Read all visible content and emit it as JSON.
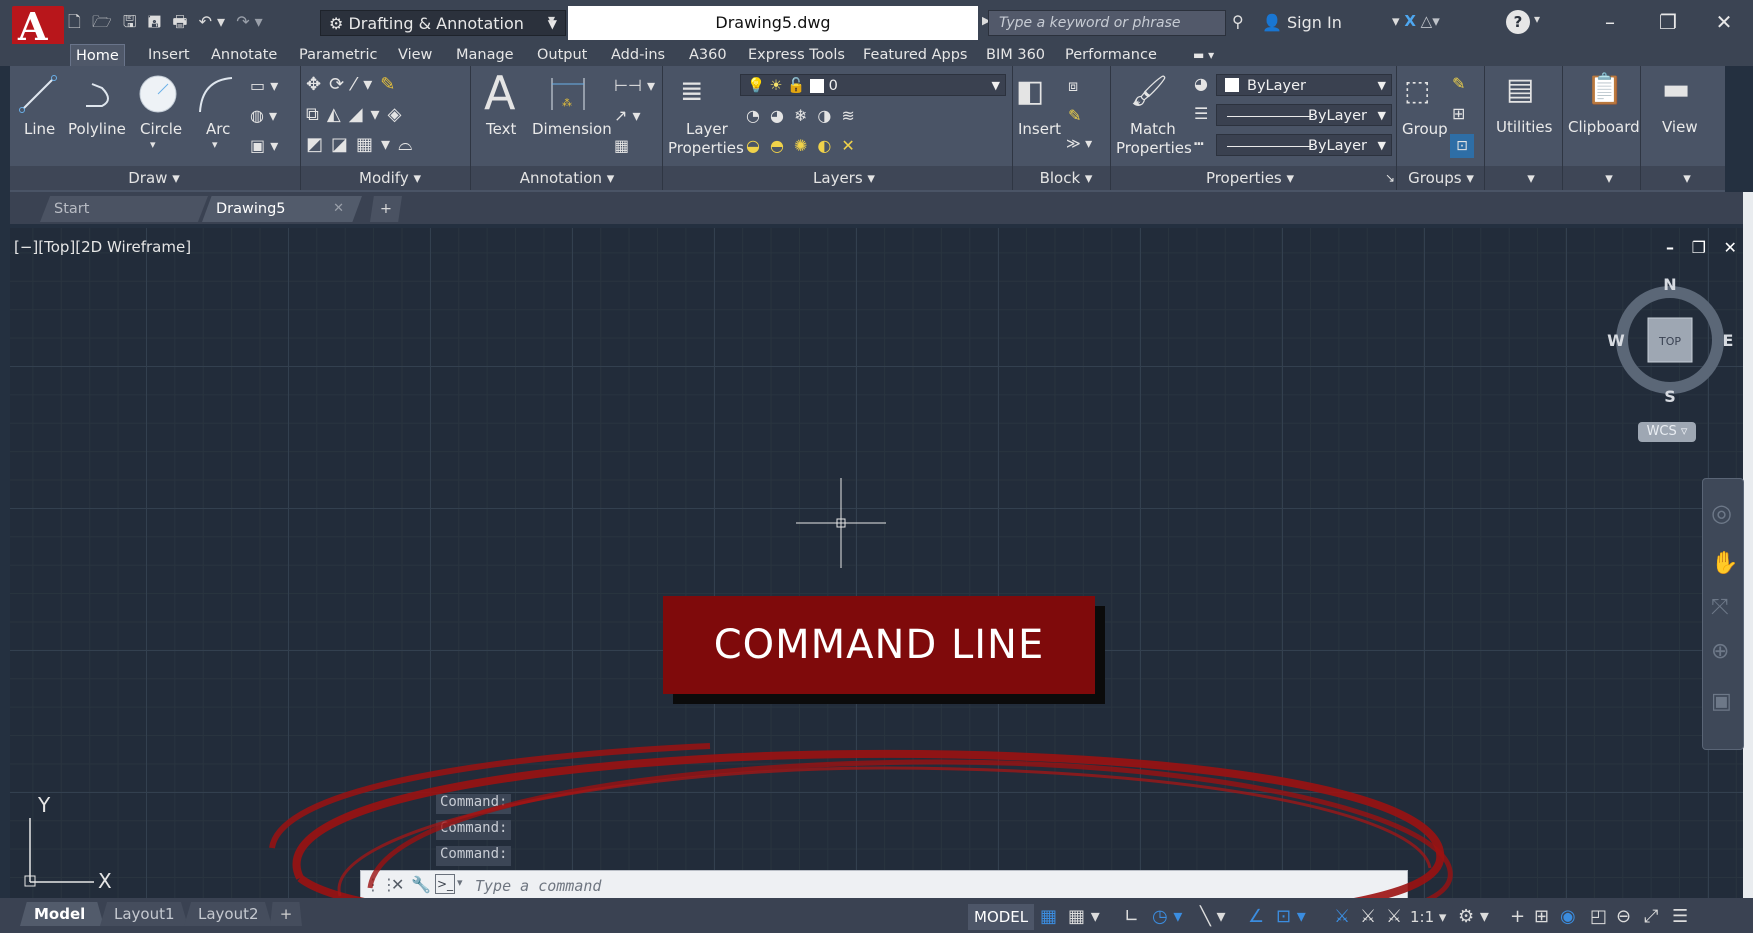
{
  "window": {
    "workspace": "Drafting & Annotation",
    "title": "Drawing5.dwg",
    "search_placeholder": "Type a keyword or phrase",
    "sign_in": "Sign In",
    "minimize": "–",
    "restore": "❐",
    "close": "✕"
  },
  "ribbon": {
    "tabs": [
      "Home",
      "Insert",
      "Annotate",
      "Parametric",
      "View",
      "Manage",
      "Output",
      "Add-ins",
      "A360",
      "Express Tools",
      "Featured Apps",
      "BIM 360",
      "Performance"
    ],
    "draw": {
      "line": "Line",
      "polyline": "Polyline",
      "circle": "Circle",
      "arc": "Arc"
    },
    "annotation": {
      "text": "Text",
      "dimension": "Dimension"
    },
    "layers": {
      "layer_properties_1": "Layer",
      "layer_properties_2": "Properties",
      "current_layer": "0"
    },
    "block": {
      "insert": "Insert"
    },
    "properties": {
      "match_1": "Match",
      "match_2": "Properties",
      "color": "ByLayer",
      "linetype": "ByLayer",
      "lineweight": "ByLayer"
    },
    "groups": {
      "group": "Group"
    },
    "utilities": "Utilities",
    "clipboard": "Clipboard",
    "view": "View",
    "panel_titles": {
      "draw": "Draw ▾",
      "modify": "Modify ▾",
      "annotation": "Annotation ▾",
      "layers": "Layers ▾",
      "block": "Block ▾",
      "properties": "Properties ▾",
      "groups": "Groups ▾"
    }
  },
  "file_tabs": {
    "start": "Start",
    "drawing": "Drawing5",
    "add": "+",
    "close": "✕"
  },
  "viewport": {
    "label": "[−][Top][2D Wireframe]",
    "controls": "– ❐ ✕",
    "compass": {
      "n": "N",
      "s": "S",
      "e": "E",
      "w": "W",
      "top": "TOP"
    },
    "wcs": "WCS ▿",
    "ucs_x": "X",
    "ucs_y": "Y"
  },
  "banner": "COMMAND LINE",
  "command": {
    "history": [
      "Command:",
      "Command:",
      "Command:"
    ],
    "placeholder": "Type a command"
  },
  "status": {
    "layouts": [
      "Model",
      "Layout1",
      "Layout2"
    ],
    "add": "+",
    "model": "MODEL",
    "scale": "1:1 ▾"
  },
  "colors": {
    "accent_red": "#7f0a0b",
    "app_red": "#b8161b",
    "canvas": "#222c3a"
  }
}
